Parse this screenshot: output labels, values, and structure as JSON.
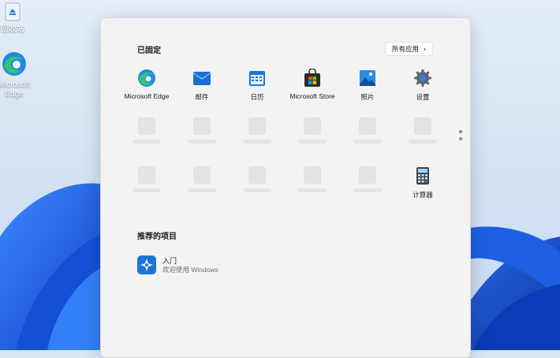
{
  "desktop": {
    "recycle_bin_label": "回收站",
    "edge_label_line1": "Microsoft",
    "edge_label_line2": "Edge"
  },
  "start_menu": {
    "pinned_title": "已固定",
    "all_apps_label": "所有应用",
    "pinned_apps": [
      {
        "label": "Microsoft Edge",
        "icon": "edge-icon"
      },
      {
        "label": "邮件",
        "icon": "mail-icon"
      },
      {
        "label": "日历",
        "icon": "calendar-icon"
      },
      {
        "label": "Microsoft Store",
        "icon": "store-icon"
      },
      {
        "label": "照片",
        "icon": "photos-icon"
      },
      {
        "label": "设置",
        "icon": "settings-icon"
      },
      {
        "label": "计算器",
        "icon": "calculator-icon"
      }
    ],
    "recommended_title": "推荐的项目",
    "recommended": [
      {
        "title": "入门",
        "subtitle": "欢迎使用 Windows",
        "icon": "get-started-icon"
      }
    ]
  },
  "colors": {
    "accent": "#0a67c9",
    "menu_bg": "#f3f3f3"
  }
}
